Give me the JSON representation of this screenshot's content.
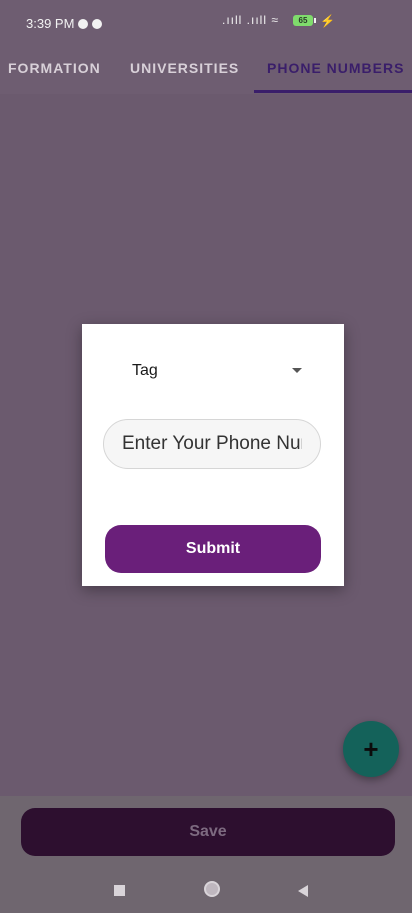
{
  "status_bar": {
    "time": "3:39 PM",
    "signal_icons": ".ııll .ııll ≈",
    "battery": "65",
    "charging_icon": "⚡"
  },
  "tabs": [
    {
      "label": "FORMATION",
      "active": false
    },
    {
      "label": "UNIVERSITIES",
      "active": false
    },
    {
      "label": "PHONE NUMBERS",
      "active": true
    }
  ],
  "dialog": {
    "tag_label": "Tag",
    "phone_placeholder": "Enter Your Phone Number",
    "submit_label": "Submit"
  },
  "fab": {
    "label": "+"
  },
  "footer": {
    "save_label": "Save"
  },
  "colors": {
    "accent": "#3a1e6a",
    "submit": "#6a1f7a",
    "fab": "#14625a",
    "save": "#2d0f2f"
  },
  "icons": [
    "circle-status-icon",
    "signal-icon",
    "wifi-icon",
    "battery-icon",
    "caret-down-icon",
    "plus-icon",
    "nav-recent-icon",
    "nav-home-icon",
    "nav-back-icon"
  ]
}
